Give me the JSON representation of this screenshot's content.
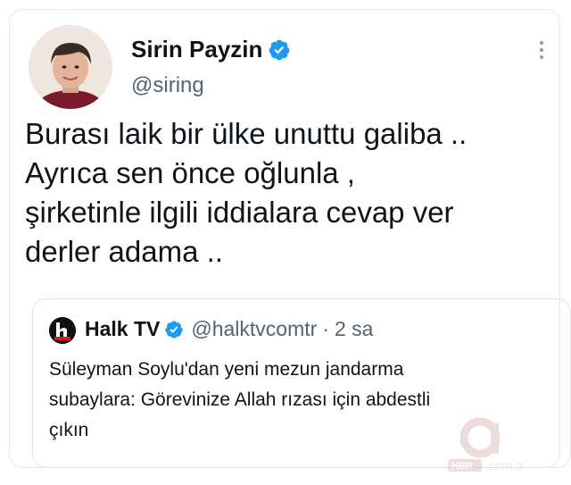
{
  "author": {
    "name": "Sirin Payzin",
    "handle": "@siring",
    "verified_icon": "verified-badge-icon",
    "avatar": "avatar-photo"
  },
  "tweet": {
    "lines": [
      "Burası laik bir ülke unuttu galiba ..",
      "Ayrıca sen önce oğlunla ,",
      "şirketinle ilgili iddialara cevap ver",
      "derler adama .."
    ]
  },
  "quoted": {
    "name": "Halk TV",
    "handle": "@halktvcomtr",
    "separator": "·",
    "time": "2 sa",
    "lines": [
      "Süleyman Soylu'dan yeni mezun jandarma",
      "subaylara: Görevinize Allah rızası için abdestli",
      "çıkın"
    ]
  },
  "colors": {
    "verified": "#1d9bf0",
    "secondary_text": "#536471",
    "border": "#e1e5e8"
  },
  "watermark": "HBR .com.tr"
}
